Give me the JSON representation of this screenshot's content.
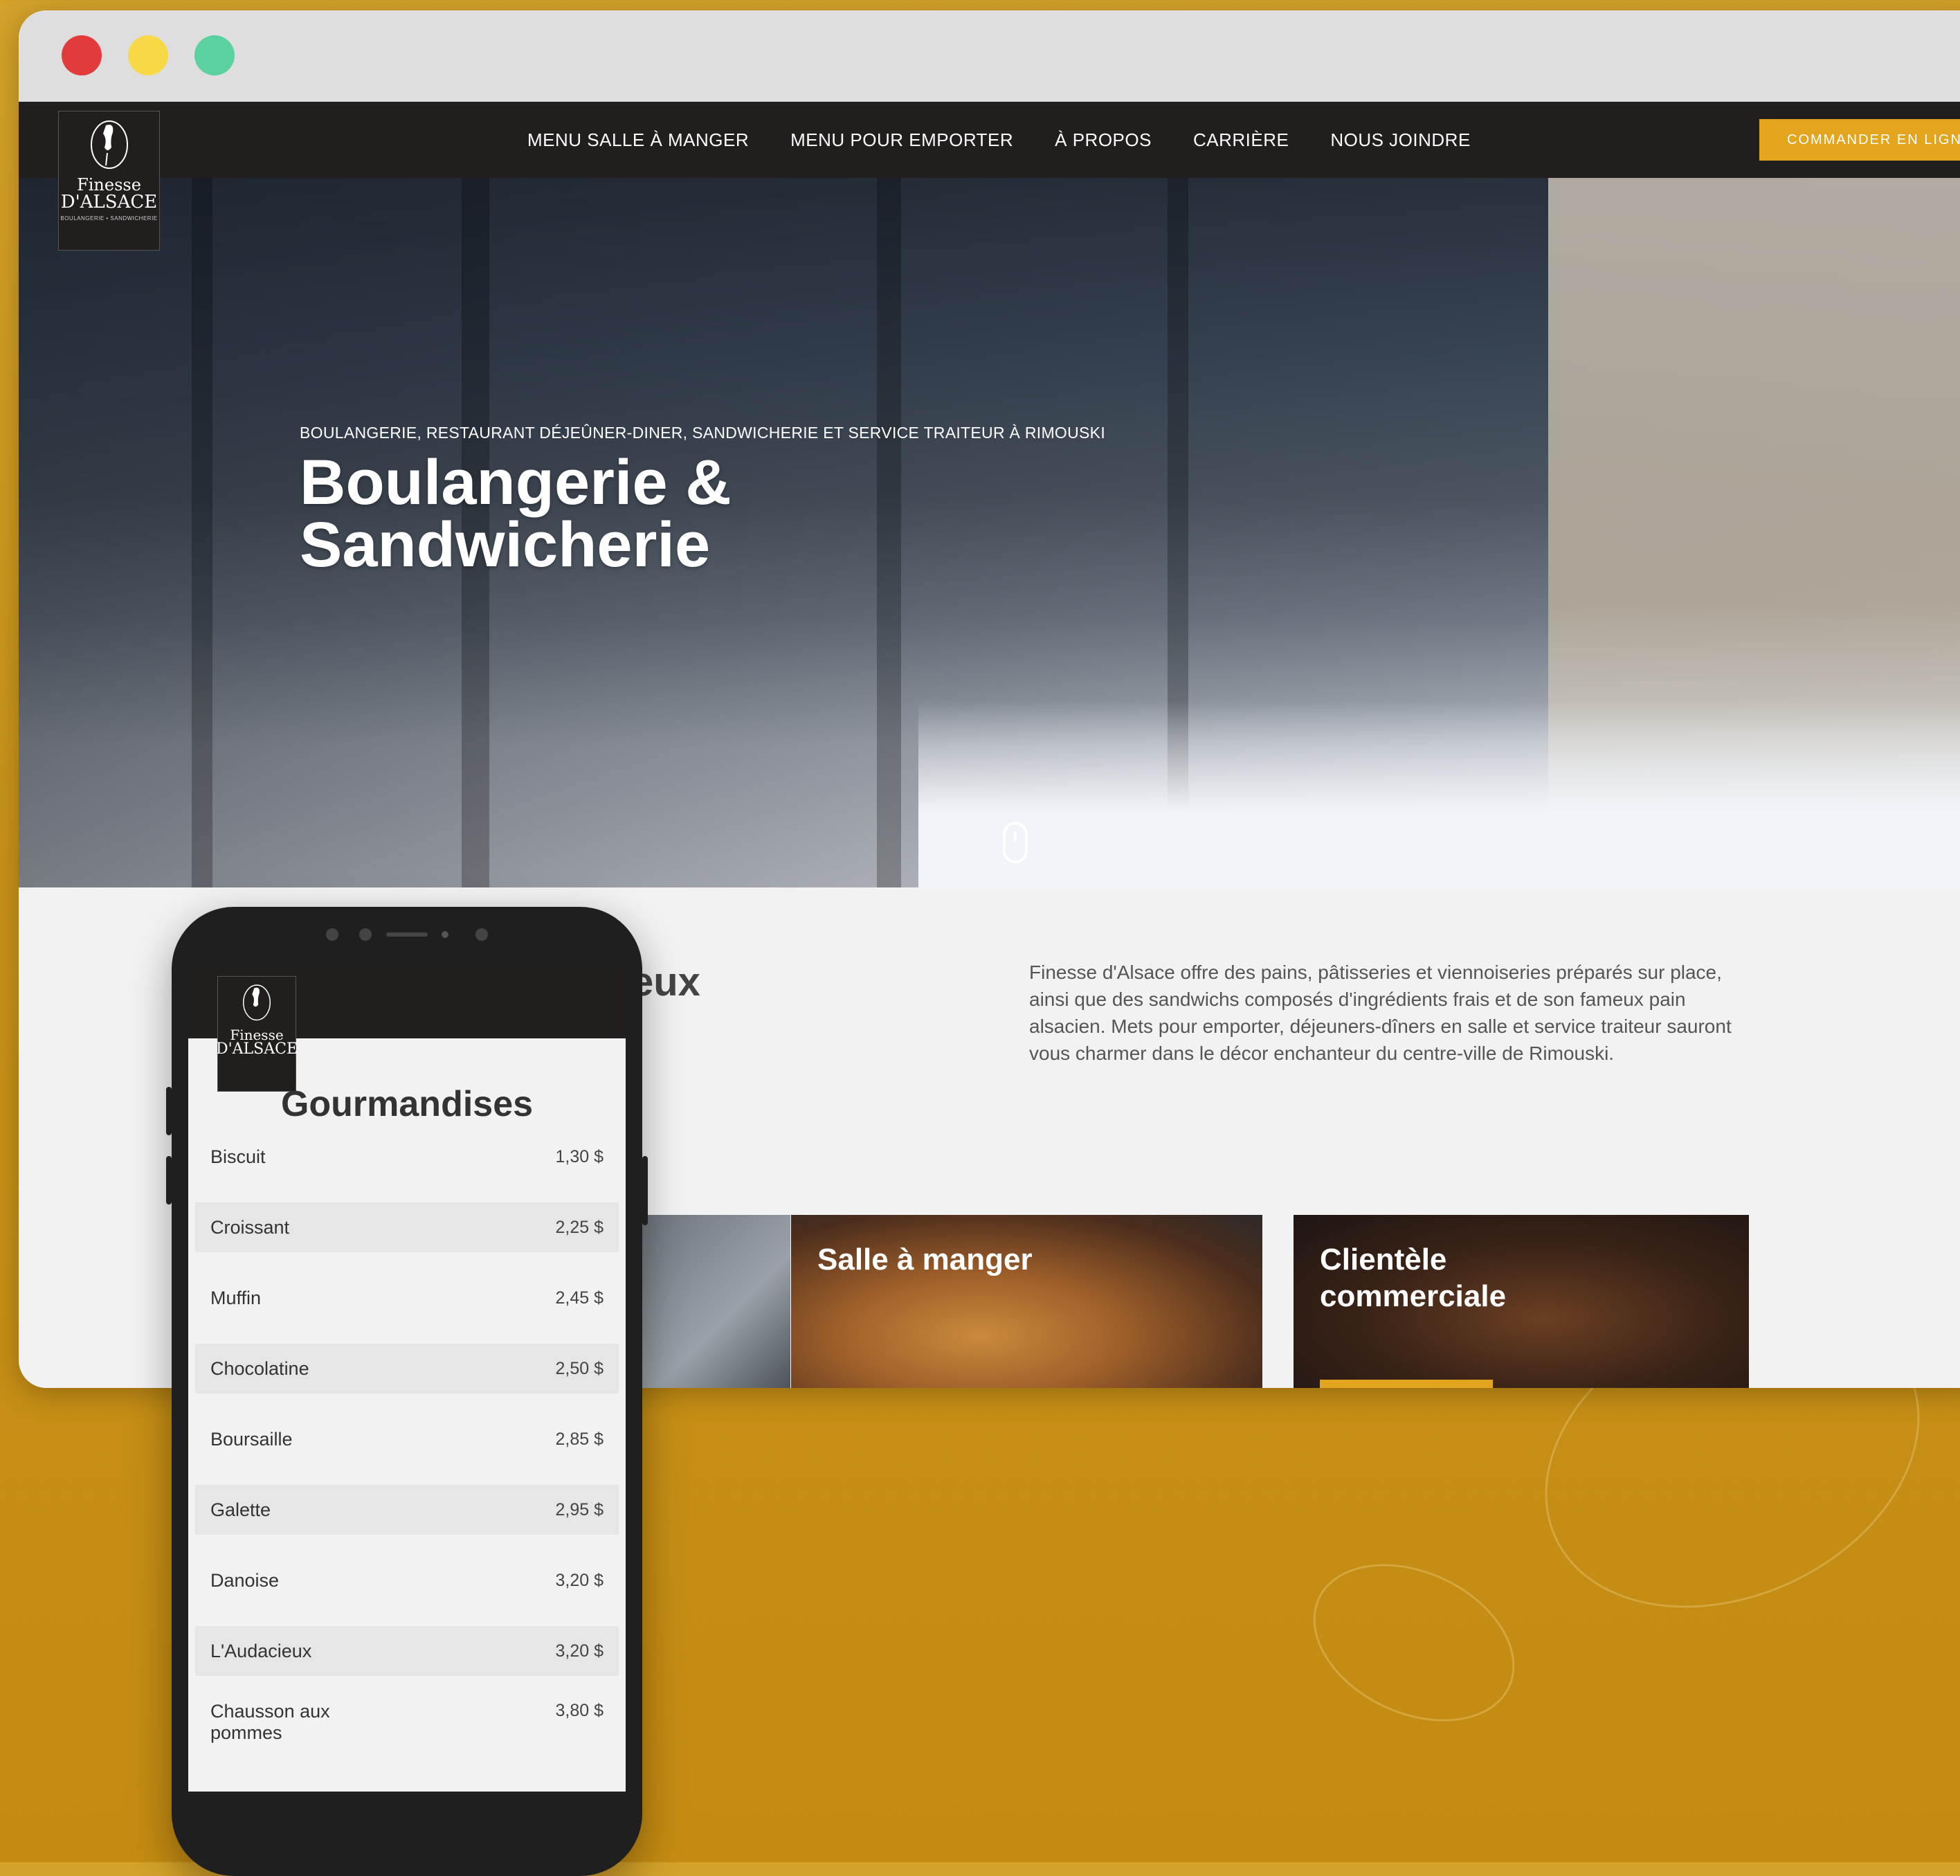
{
  "browser": {
    "dots": [
      "#e23b3b",
      "#f7d947",
      "#5cd1a0"
    ]
  },
  "brand": {
    "logo_line1": "Finesse",
    "logo_line2": "D'ALSACE",
    "logo_tag": "BOULANGERIE • SANDWICHERIE"
  },
  "nav": {
    "items": [
      "MENU SALLE À MANGER",
      "MENU POUR EMPORTER",
      "À PROPOS",
      "CARRIÈRE",
      "NOUS JOINDRE"
    ],
    "cta": "COMMANDER EN LIGNE"
  },
  "hero": {
    "kicker": "BOULANGERIE, RESTAURANT DÉJEÛNER-DINER, SANDWICHERIE ET SERVICE TRAITEUR À RIMOUSKI",
    "title_line1": "Boulangerie &",
    "title_line2": "Sandwicherie"
  },
  "about": {
    "partial_heading": "eux",
    "description": "Finesse d'Alsace offre des pains, pâtisseries et viennoiseries préparés sur place, ainsi que des sandwichs composés d'ingrédients frais et de son fameux pain alsacien. Mets pour emporter, déjeuners-dîners en salle et service traiteur sauront vous charmer dans le décor enchanteur du centre-ville de Rimouski."
  },
  "cards": [
    {
      "title": "Salle à manger"
    },
    {
      "title": "Clientèle commerciale"
    }
  ],
  "phone": {
    "section_title": "Gourmandises",
    "items": [
      {
        "name": "Biscuit",
        "price": "1,30 $"
      },
      {
        "name": "Croissant",
        "price": "2,25 $"
      },
      {
        "name": "Muffin",
        "price": "2,45 $"
      },
      {
        "name": "Chocolatine",
        "price": "2,50 $"
      },
      {
        "name": "Boursaille",
        "price": "2,85 $"
      },
      {
        "name": "Galette",
        "price": "2,95 $"
      },
      {
        "name": "Danoise",
        "price": "3,20 $"
      },
      {
        "name": "L'Audacieux",
        "price": "3,20 $"
      },
      {
        "name": "Chausson aux pommes",
        "price": "3,80 $"
      }
    ]
  },
  "colors": {
    "accent": "#e3a51d",
    "nav_bg": "#221e1e",
    "background": "#c8921a"
  }
}
